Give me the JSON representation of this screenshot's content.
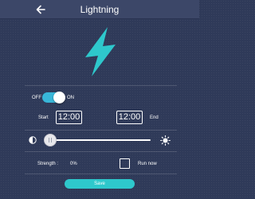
{
  "header": {
    "title": "Lightning",
    "back_icon": "arrow-left-icon"
  },
  "hero": {
    "icon": "lightning-bolt-icon",
    "color": "#2ec8cc"
  },
  "power": {
    "off_label": "OFF",
    "on_label": "ON",
    "state": "on"
  },
  "schedule": {
    "start_label": "Start",
    "start_time": "12:00",
    "end_time": "12:00",
    "end_label": "End"
  },
  "brightness": {
    "min_icon": "half-circle-icon",
    "max_icon": "sun-icon",
    "value": 0
  },
  "strength": {
    "label": "Strength :",
    "value": "0%"
  },
  "run_now": {
    "label": "Run now",
    "checked": false
  },
  "save_label": "Save",
  "colors": {
    "accent": "#2ec8cc",
    "toggle": "#38b6d8",
    "background": "#2f3a59",
    "header": "#3c4768"
  }
}
